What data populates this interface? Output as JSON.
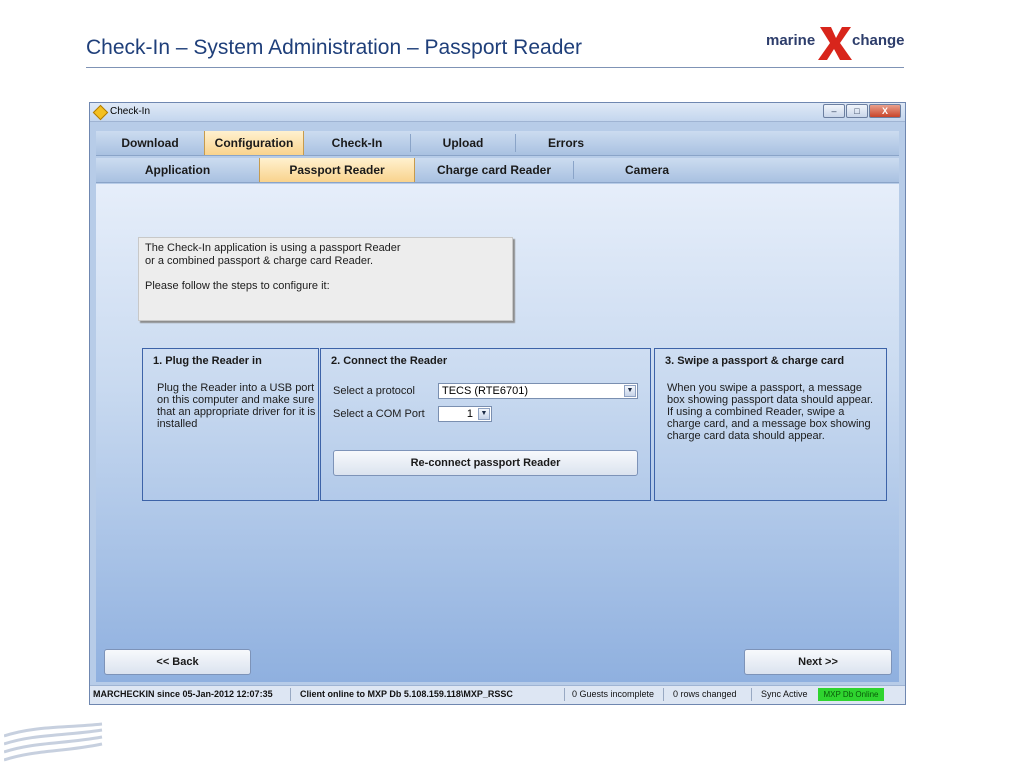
{
  "slide": {
    "title": "Check-In – System Administration – Passport Reader",
    "logo_left": "marine",
    "logo_right": "change"
  },
  "window": {
    "title": "Check-In",
    "controls": {
      "minimize": "–",
      "maximize": "□",
      "close": "X"
    }
  },
  "tabs_main": [
    {
      "label": "Download",
      "active": false
    },
    {
      "label": "Configuration",
      "active": true
    },
    {
      "label": "Check-In",
      "active": false
    },
    {
      "label": "Upload",
      "active": false
    },
    {
      "label": "Errors",
      "active": false
    }
  ],
  "tabs_sub": [
    {
      "label": "Application",
      "active": false
    },
    {
      "label": "Passport Reader",
      "active": true
    },
    {
      "label": "Charge card Reader",
      "active": false
    },
    {
      "label": "Camera",
      "active": false
    }
  ],
  "intro": {
    "line1": "The Check-In application is using a passport Reader",
    "line2": "or a combined passport & charge card Reader.",
    "line3": "Please follow the steps to configure it:"
  },
  "step1": {
    "title": "1. Plug the Reader in",
    "text": "Plug the Reader into a USB port on this computer and make sure that an appropriate driver for it is installed"
  },
  "step2": {
    "title": "2. Connect the Reader",
    "protocol_label": "Select a protocol",
    "protocol_value": "TECS (RTE6701)",
    "com_label": "Select a COM Port",
    "com_value": "1",
    "reconnect_label": "Re-connect passport Reader"
  },
  "step3": {
    "title": "3. Swipe a passport & charge card",
    "text": "When you swipe a passport, a message box showing passport data should appear. If using a combined Reader, swipe a charge card, and a message box showing charge card data should appear."
  },
  "nav": {
    "back_label": "<< Back",
    "next_label": "Next >>"
  },
  "status": {
    "since": "MARCHECKIN since 05-Jan-2012 12:07:35",
    "client": "Client online to MXP Db 5.108.159.118\\MXP_RSSC",
    "guests": "0 Guests incomplete",
    "rows": "0 rows changed",
    "sync": "Sync Active",
    "db": "MXP Db Online"
  },
  "colors": {
    "accent_active_tab": "#f9d38d",
    "panel_border": "#3d63a8",
    "online_indicator": "#2fd42f",
    "logo_x": "#d8251b"
  }
}
